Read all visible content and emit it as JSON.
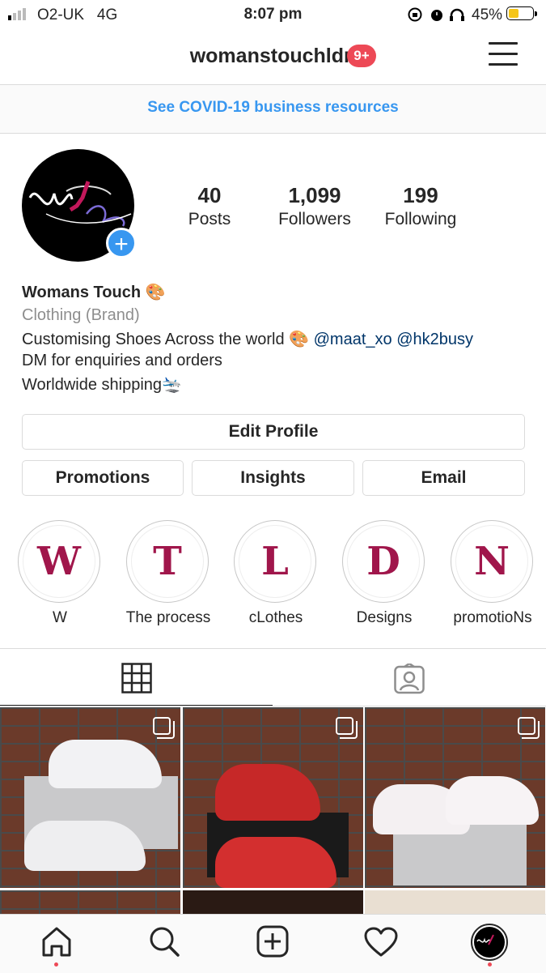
{
  "status_bar": {
    "carrier": "O2-UK",
    "network": "4G",
    "time": "8:07 pm",
    "battery": "45%",
    "battery_level": 0.45
  },
  "header": {
    "username": "womanstouchldn",
    "notification_badge": "9+"
  },
  "banner": {
    "text": "See COVID-19 business resources"
  },
  "profile": {
    "stats": [
      {
        "value": "40",
        "label": "Posts"
      },
      {
        "value": "1,099",
        "label": "Followers"
      },
      {
        "value": "199",
        "label": "Following"
      }
    ],
    "name": "Womans Touch 🎨",
    "category": "Clothing (Brand)",
    "bio_line1_text": "Customising Shoes Across the world 🎨 ",
    "mention1": "@maat_xo",
    "mention2": "@hk2busy",
    "bio_line2": "DM for enquiries and orders",
    "bio_line3": "Worldwide shipping🛬"
  },
  "buttons": {
    "edit_profile": "Edit Profile",
    "promotions": "Promotions",
    "insights": "Insights",
    "email": "Email"
  },
  "highlights": [
    {
      "letter": "W",
      "label": "W"
    },
    {
      "letter": "T",
      "label": "The process"
    },
    {
      "letter": "L",
      "label": "cLothes"
    },
    {
      "letter": "D",
      "label": "Designs"
    },
    {
      "letter": "N",
      "label": "promotioNs"
    }
  ],
  "tabs": {
    "active": "grid",
    "icons": [
      "grid-icon",
      "tagged-icon"
    ]
  },
  "colors": {
    "accent": "#3897f0",
    "badge": "#ed4956",
    "highlight_letter": "#a0164b"
  },
  "bottom_nav": {
    "icons": [
      "home-icon",
      "search-icon",
      "add-post-icon",
      "heart-icon",
      "profile-avatar"
    ]
  }
}
